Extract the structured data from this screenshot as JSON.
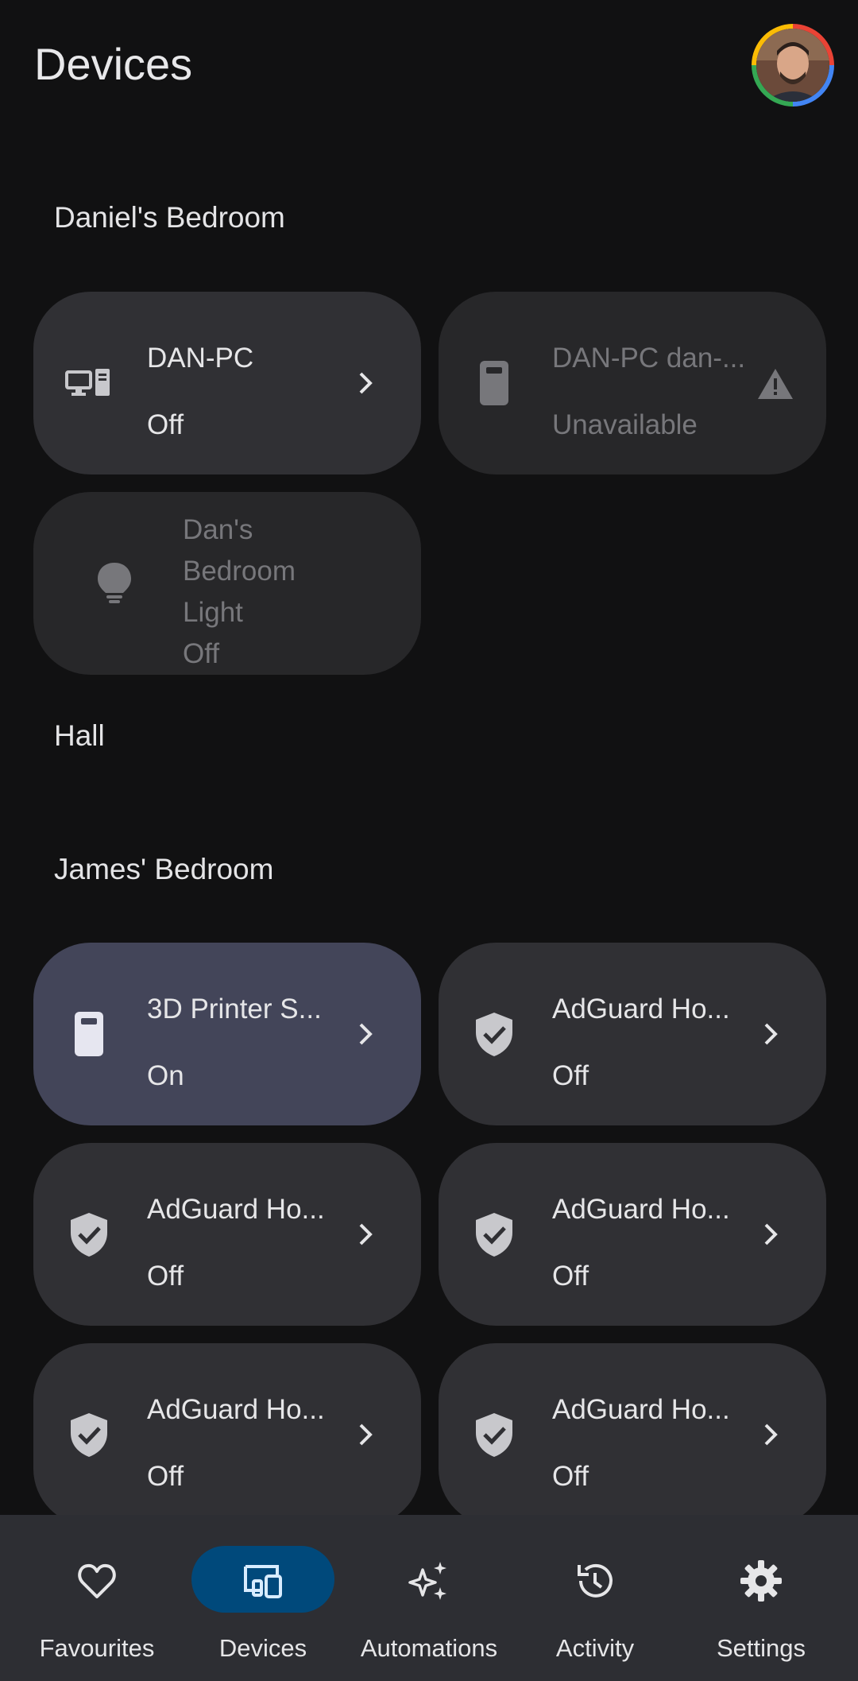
{
  "header": {
    "title": "Devices",
    "avatar_icon": "user-avatar"
  },
  "sections": [
    {
      "title": "Daniel's Bedroom"
    },
    {
      "title": "Hall"
    },
    {
      "title": "James' Bedroom"
    }
  ],
  "devices": [
    {
      "name": "DAN-PC",
      "state": "Off",
      "icon": "pc-icon"
    },
    {
      "name": "DAN-PC dan-...",
      "state": "Unavailable",
      "icon": "phone-icon"
    },
    {
      "name": "Dan's Bedroom Light",
      "state": "Off",
      "icon": "lightbulb-icon"
    },
    {
      "name": "3D Printer S...",
      "state": "On",
      "icon": "plug-icon"
    },
    {
      "name": "AdGuard Ho...",
      "state": "Off",
      "icon": "shield-check-icon"
    },
    {
      "name": "AdGuard Ho...",
      "state": "Off",
      "icon": "shield-check-icon"
    },
    {
      "name": "AdGuard Ho...",
      "state": "Off",
      "icon": "shield-check-icon"
    },
    {
      "name": "AdGuard Ho...",
      "state": "Off",
      "icon": "shield-check-icon"
    },
    {
      "name": "AdGuard Ho...",
      "state": "Off",
      "icon": "shield-check-icon"
    }
  ],
  "nav": [
    {
      "label": "Favourites",
      "icon": "heart-icon"
    },
    {
      "label": "Devices",
      "icon": "devices-icon",
      "active": true
    },
    {
      "label": "Automations",
      "icon": "sparkle-icon"
    },
    {
      "label": "Activity",
      "icon": "history-icon"
    },
    {
      "label": "Settings",
      "icon": "gear-icon"
    }
  ],
  "colors": {
    "background": "#111112",
    "tile": "#303034",
    "tile_active": "#434559",
    "nav_active": "#00497b"
  }
}
